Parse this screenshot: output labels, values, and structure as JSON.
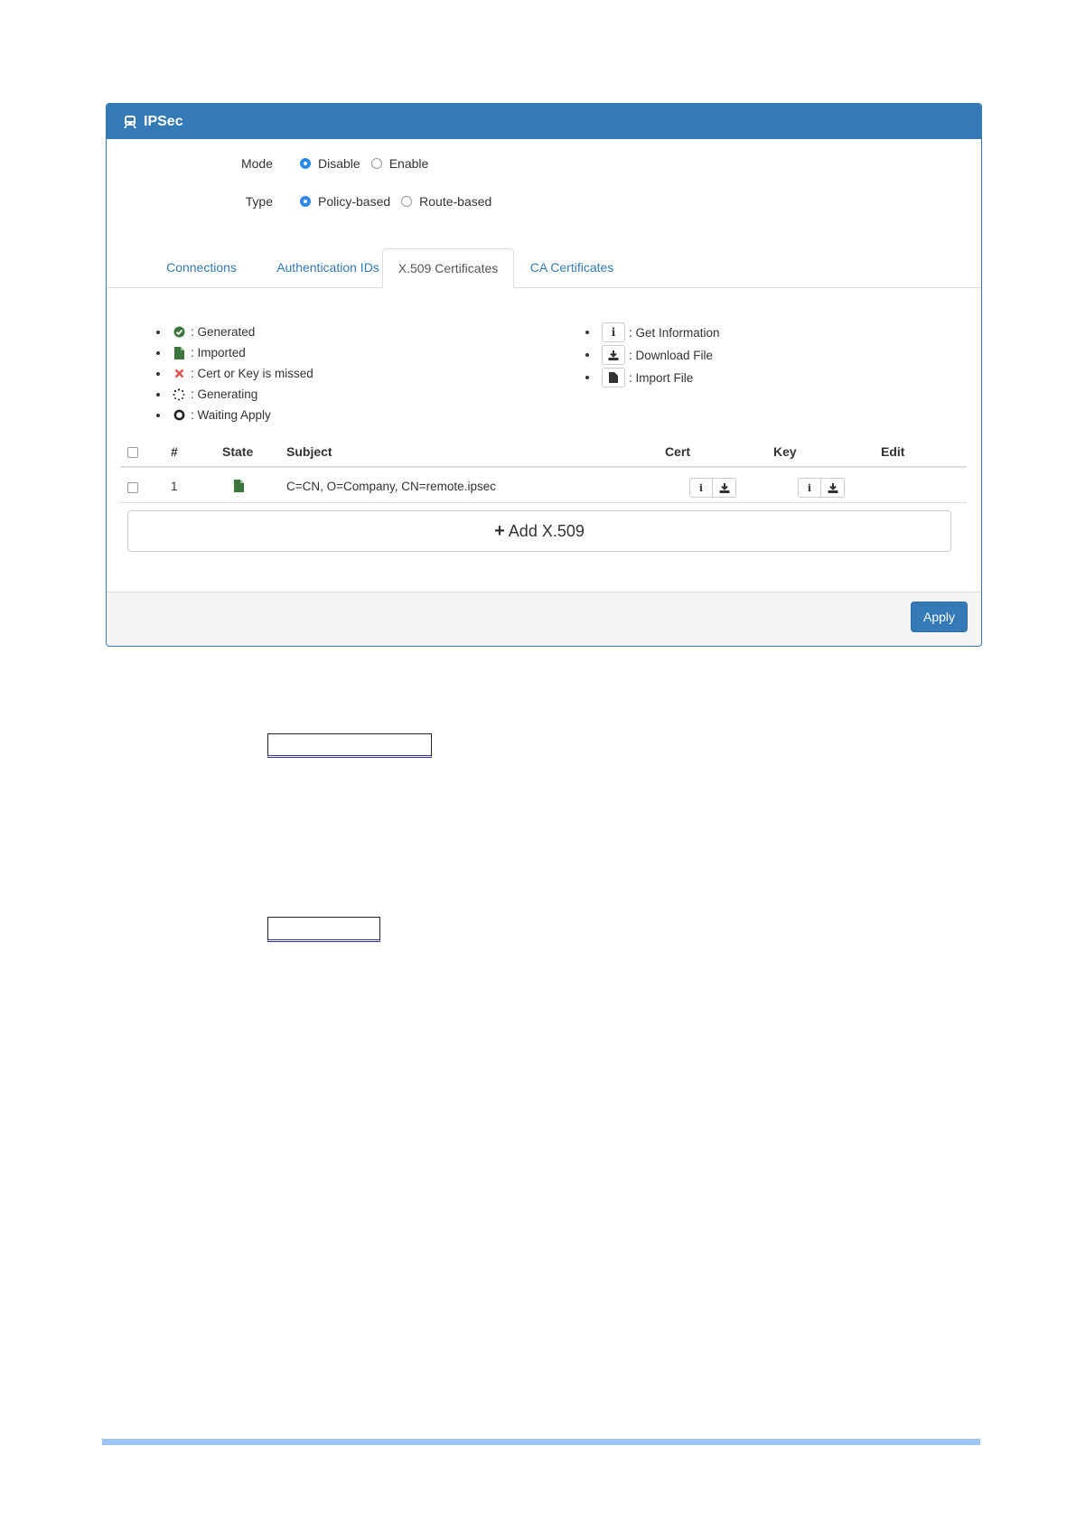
{
  "panel": {
    "title": "IPSec",
    "title_icon": "train-icon"
  },
  "form": {
    "mode": {
      "label": "Mode",
      "options": [
        "Disable",
        "Enable"
      ],
      "selected": "Disable"
    },
    "type": {
      "label": "Type",
      "options": [
        "Policy-based",
        "Route-based"
      ],
      "selected": "Policy-based"
    }
  },
  "tabs": [
    "Connections",
    "Authentication IDs",
    "X.509 Certificates",
    "CA Certificates"
  ],
  "active_tab": "X.509 Certificates",
  "legend": {
    "states": [
      {
        "icon": "check-circle-icon",
        "text": ": Generated"
      },
      {
        "icon": "file-icon",
        "text": ": Imported"
      },
      {
        "icon": "x-icon",
        "text": ": Cert or Key is missed"
      },
      {
        "icon": "spinner-icon",
        "text": ": Generating"
      },
      {
        "icon": "circle-o-icon",
        "text": ": Waiting Apply"
      }
    ],
    "actions": [
      {
        "icon": "info-icon",
        "text": ": Get Information"
      },
      {
        "icon": "download-icon",
        "text": ": Download File"
      },
      {
        "icon": "file-icon",
        "text": ": Import File"
      }
    ]
  },
  "table": {
    "headers": [
      "#",
      "State",
      "Subject",
      "Cert",
      "Key",
      "Edit"
    ],
    "rows": [
      {
        "num": "1",
        "state_icon": "file-icon",
        "subject": "C=CN, O=Company, CN=remote.ipsec"
      }
    ]
  },
  "add_button": "Add X.509",
  "apply_button": "Apply",
  "colors": {
    "primary": "#337ab7",
    "radio": "#2a89ea",
    "imported": "#3c763d",
    "missing": "#d9534f",
    "generated": "#3c763d"
  }
}
